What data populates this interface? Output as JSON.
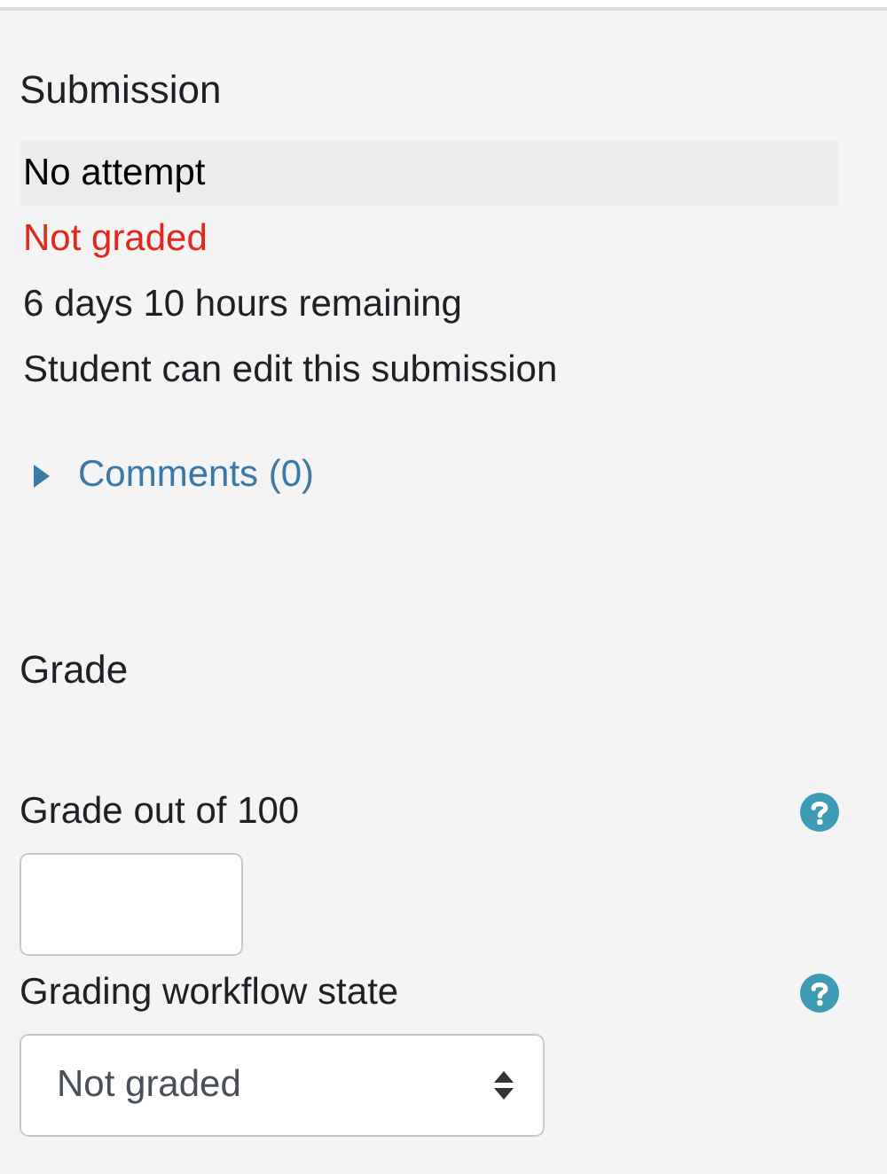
{
  "submission": {
    "title": "Submission",
    "rows": [
      {
        "text": "No attempt",
        "kind": "highlight"
      },
      {
        "text": "Not graded",
        "kind": "alert"
      },
      {
        "text": "6 days 10 hours remaining",
        "kind": "plain"
      },
      {
        "text": "Student can edit this submission",
        "kind": "plain"
      }
    ],
    "comments": {
      "label": "Comments (0)",
      "expanded": false
    }
  },
  "grade": {
    "title": "Grade",
    "fields": [
      {
        "label": "Grade out of 100",
        "kind": "text"
      },
      {
        "label": "Grading workflow state",
        "kind": "select",
        "value": "Not graded"
      }
    ]
  }
}
